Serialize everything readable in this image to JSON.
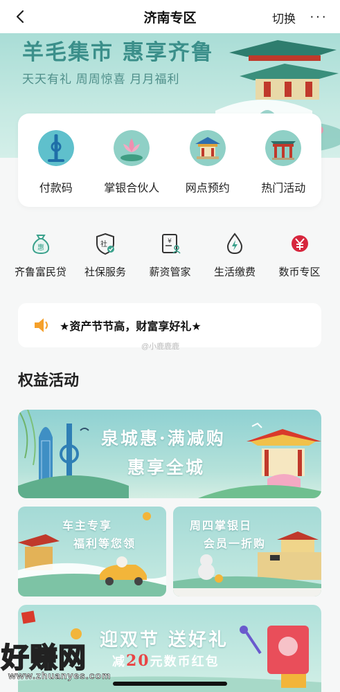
{
  "nav": {
    "title": "济南专区",
    "switch_label": "切换",
    "more_label": "···"
  },
  "hero": {
    "title": "羊毛集市 惠享齐鲁",
    "subtitle": "天天有礼 周周惊喜 月月福利"
  },
  "quick_actions": [
    {
      "label": "付款码",
      "icon": "fountain-tower-icon"
    },
    {
      "label": "掌银合伙人",
      "icon": "lotus-icon"
    },
    {
      "label": "网点预约",
      "icon": "pavilion-icon"
    },
    {
      "label": "热门活动",
      "icon": "gate-icon"
    }
  ],
  "services": [
    {
      "label": "齐鲁富民贷",
      "icon": "money-bag-icon"
    },
    {
      "label": "社保服务",
      "icon": "shield-check-icon"
    },
    {
      "label": "薪资管家",
      "icon": "salary-doc-icon"
    },
    {
      "label": "生活缴费",
      "icon": "water-drop-bolt-icon"
    },
    {
      "label": "数币专区",
      "icon": "digital-yuan-icon"
    }
  ],
  "notice": {
    "text": "★资产节节高，财富享好礼★",
    "watermark": "@小鹿鹿鹿"
  },
  "section": {
    "title": "权益活动"
  },
  "banners": {
    "main": {
      "line1": "泉城惠·满减购",
      "line2": "惠享全城"
    },
    "left": {
      "line1": "车主专享",
      "line2": "福利等您领"
    },
    "right": {
      "line1": "周四掌银日",
      "line2": "会员一折购"
    },
    "bottom": {
      "line1": "迎双节 送好礼",
      "line2_prefix": "减",
      "line2_num": "20",
      "line2_suffix": "元数币红包"
    }
  },
  "site_watermark": {
    "name": "好赚网",
    "url": "www.zhuanyes.com"
  },
  "colors": {
    "accent_teal": "#3b8f8a",
    "hero_bg": "#a9ddd6",
    "red": "#d7263d"
  }
}
